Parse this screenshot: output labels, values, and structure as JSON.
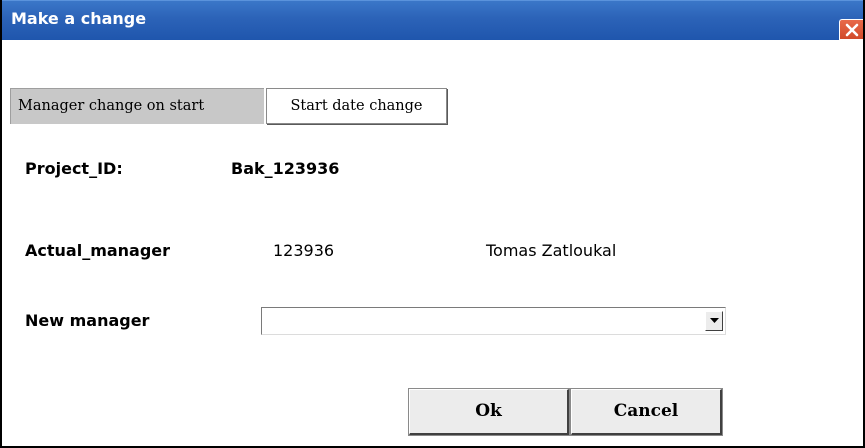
{
  "window": {
    "title": "Make a change",
    "titlebar_color": "#2c63b8",
    "close_color": "#d14a2a"
  },
  "tabs": [
    {
      "label": "Manager change on start",
      "active": true
    },
    {
      "label": "Start date change",
      "active": false
    }
  ],
  "form": {
    "project_id_label": "Project_ID:",
    "project_id_value": "Bak_123936",
    "actual_manager_label": "Actual_manager",
    "actual_manager_id": "123936",
    "actual_manager_name": "Tomas Zatloukal",
    "new_manager_label": "New manager",
    "new_manager_selected": ""
  },
  "buttons": {
    "ok_label": "Ok",
    "cancel_label": "Cancel"
  },
  "icons": {
    "close": "close-icon",
    "dropdown": "chevron-down-icon"
  }
}
